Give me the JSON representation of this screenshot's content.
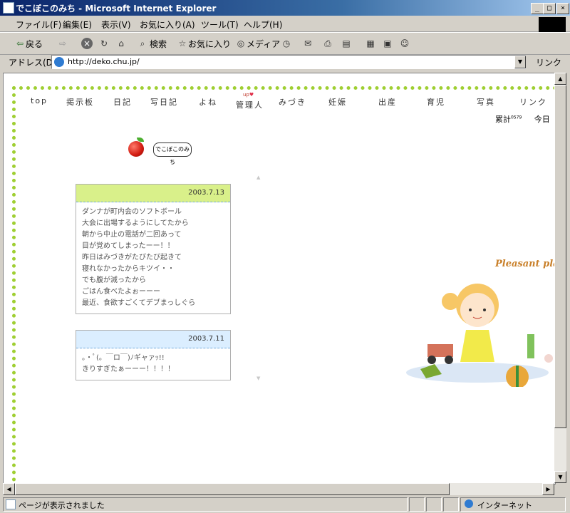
{
  "window": {
    "title": "でこぼこのみち - Microsoft Internet Explorer"
  },
  "menu": [
    "ファイル(F)",
    "編集(E)",
    "表示(V)",
    "お気に入り(A)",
    "ツール(T)",
    "ヘルプ(H)"
  ],
  "toolbar": {
    "back": "戻る",
    "search": "検索",
    "favorites": "お気に入り",
    "media": "メディア"
  },
  "address": {
    "label": "アドレス(D)",
    "url": "http://deko.chu.jp/",
    "links": "リンク"
  },
  "nav": [
    "top",
    "掲示板",
    "日記",
    "写日記",
    "よね",
    "管理人",
    "みづき",
    "妊娠",
    "出産",
    "育児",
    "写真",
    "リンク"
  ],
  "nav_up": "up",
  "stats": {
    "total": "累計",
    "total_sup": "0579",
    "today": "今日"
  },
  "logo": {
    "text": "でこぼこのみち"
  },
  "entries": [
    {
      "date": "2003.7.13",
      "header_color": "#d9f08a",
      "lines": [
        "ダンナが町内会のソフトボール",
        "大会に出場するようにしてたから",
        "朝から中止の電話が二回あって",
        "目が覚めてしまったーー！！",
        "昨日はみづきがたびたび起きて",
        "寝れなかったからキツイ・・",
        "でも腹が減ったから",
        "ごはん食べたよぉーーー",
        "最近、食欲すごくてデブまっしぐら"
      ]
    },
    {
      "date": "2003.7.11",
      "header_color": "#dbeeff",
      "lines": [
        "。・ﾟ(。￣ロ￣)ﾉギャァｯ!!",
        "きりすぎたぁーーー！！！！"
      ]
    }
  ],
  "illustration": {
    "caption": "Pleasant pla"
  },
  "status": {
    "text": "ページが表示されました",
    "zone": "インターネット"
  },
  "colors": {
    "frame_dots": "#9fcf32",
    "titlebar": "#0a246a"
  }
}
